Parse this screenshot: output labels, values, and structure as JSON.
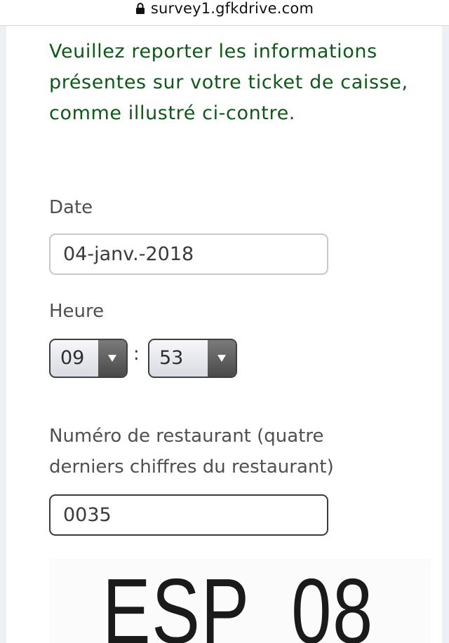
{
  "browser": {
    "url": "survey1.gfkdrive.com"
  },
  "form": {
    "instructions": "Veuillez reporter les informations présentes sur votre ticket de caisse, comme illustré ci-contre.",
    "date_label": "Date",
    "date_value": "04-janv.-2018",
    "time_label": "Heure",
    "hour_value": "09",
    "time_separator": ":",
    "minute_value": "53",
    "restaurant_label_line1": "Numéro de restaurant (quatre",
    "restaurant_label_line2": "derniers chiffres du restaurant)",
    "restaurant_value": "0035"
  },
  "receipt_image": {
    "text": "ESP  08"
  },
  "icons": {
    "lock": "lock-icon",
    "dropdown": "triangle-down-icon"
  },
  "colors": {
    "instruction_text": "#0b5a16",
    "label_text": "#4f4f4f",
    "side_background": "#eef0f6"
  }
}
